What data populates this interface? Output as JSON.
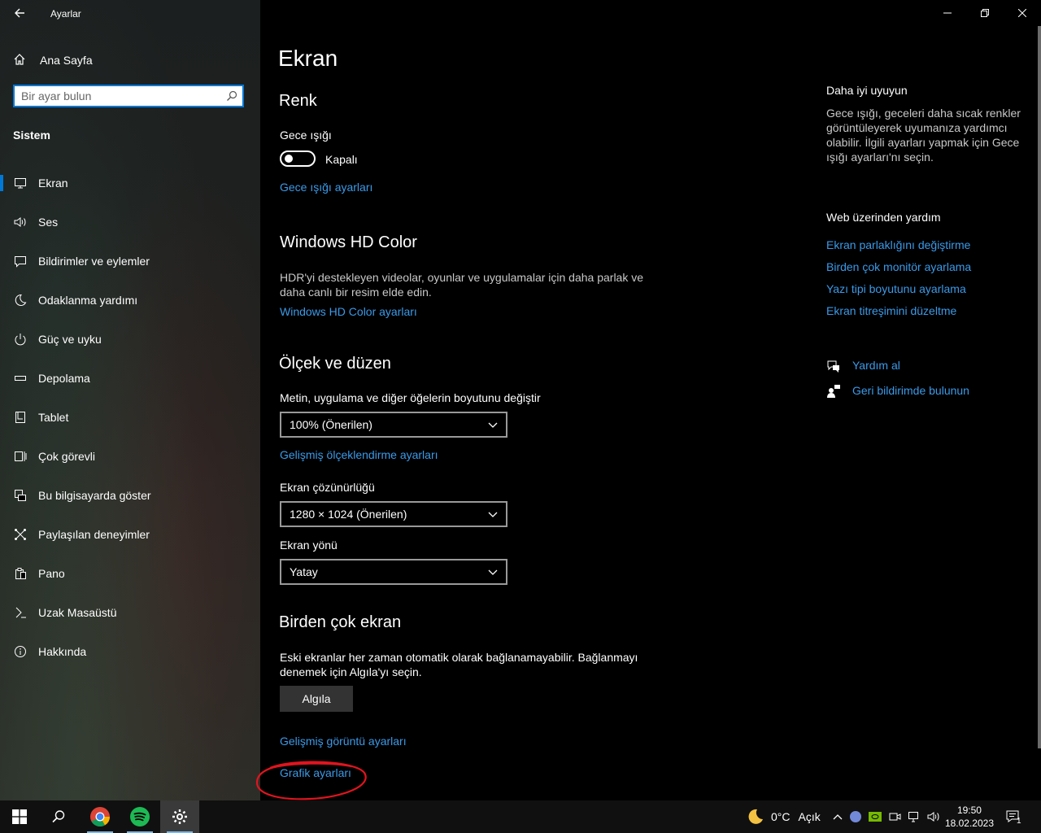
{
  "window": {
    "title": "Ayarlar"
  },
  "sidebar": {
    "home_label": "Ana Sayfa",
    "search_placeholder": "Bir ayar bulun",
    "section_title": "Sistem",
    "items": [
      {
        "label": "Ekran",
        "icon": "monitor-icon",
        "active": true
      },
      {
        "label": "Ses",
        "icon": "speaker-icon"
      },
      {
        "label": "Bildirimler ve eylemler",
        "icon": "notification-icon"
      },
      {
        "label": "Odaklanma yardımı",
        "icon": "moon-icon"
      },
      {
        "label": "Güç ve uyku",
        "icon": "power-icon"
      },
      {
        "label": "Depolama",
        "icon": "storage-icon"
      },
      {
        "label": "Tablet",
        "icon": "tablet-icon"
      },
      {
        "label": "Çok görevli",
        "icon": "multitasking-icon"
      },
      {
        "label": "Bu bilgisayarda göster",
        "icon": "project-icon"
      },
      {
        "label": "Paylaşılan deneyimler",
        "icon": "shared-icon"
      },
      {
        "label": "Pano",
        "icon": "clipboard-icon"
      },
      {
        "label": "Uzak Masaüstü",
        "icon": "remote-desktop-icon"
      },
      {
        "label": "Hakkında",
        "icon": "info-icon"
      }
    ]
  },
  "main": {
    "page_title": "Ekran",
    "renk": {
      "title": "Renk",
      "night_light_label": "Gece ışığı",
      "night_light_state": "Kapalı",
      "night_light_link": "Gece ışığı ayarları"
    },
    "hdr": {
      "title": "Windows HD Color",
      "description": "HDR'yi destekleyen videolar, oyunlar ve uygulamalar için daha parlak ve daha canlı bir resim elde edin.",
      "link": "Windows HD Color ayarları"
    },
    "scale": {
      "title": "Ölçek ve düzen",
      "size_label": "Metin, uygulama ve diğer öğelerin boyutunu değiştir",
      "size_value": "100% (Önerilen)",
      "advanced_link": "Gelişmiş ölçeklendirme ayarları",
      "resolution_label": "Ekran çözünürlüğü",
      "resolution_value": "1280 × 1024 (Önerilen)",
      "orientation_label": "Ekran yönü",
      "orientation_value": "Yatay"
    },
    "multi": {
      "title": "Birden çok ekran",
      "description": "Eski ekranlar her zaman otomatik olarak bağlanamayabilir. Bağlanmayı denemek için Algıla'yı seçin.",
      "detect_button": "Algıla",
      "advanced_display_link": "Gelişmiş görüntü ayarları",
      "graphics_link": "Grafik ayarları"
    }
  },
  "right_panel": {
    "sleep_title": "Daha iyi uyuyun",
    "sleep_text": "Gece ışığı, geceleri daha sıcak renkler görüntüleyerek uyumanıza yardımcı olabilir. İlgili ayarları yapmak için Gece ışığı ayarları'nı seçin.",
    "web_help_title": "Web üzerinden yardım",
    "links": [
      "Ekran parlaklığını değiştirme",
      "Birden çok monitör ayarlama",
      "Yazı tipi boyutunu ayarlama",
      "Ekran titreşimini düzeltme"
    ],
    "get_help": "Yardım al",
    "feedback": "Geri bildirimde bulunun"
  },
  "taskbar": {
    "weather_temp": "0°C",
    "weather_desc": "Açık",
    "time": "19:50",
    "date": "18.02.2023",
    "notification_count": "1"
  },
  "colors": {
    "accent": "#0078d7",
    "link": "#3b9ae8",
    "annotation": "#e0141e"
  }
}
